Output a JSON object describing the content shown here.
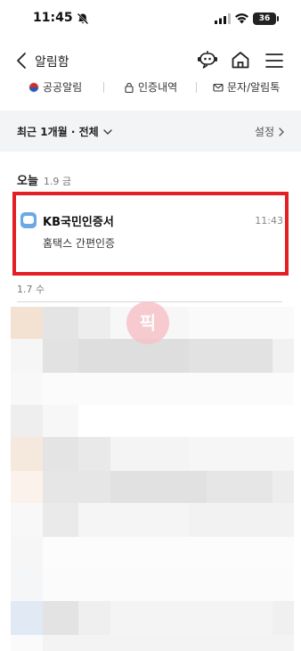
{
  "status_bar": {
    "time": "11:45",
    "battery": "36"
  },
  "header": {
    "title": "알림함"
  },
  "tabs": [
    {
      "label": "공공알림",
      "icon": "korea-flag-icon"
    },
    {
      "label": "인증내역",
      "icon": "lock-icon"
    },
    {
      "label": "문자/알림톡",
      "icon": "envelope-icon"
    }
  ],
  "filter": {
    "label": "최근 1개월 · 전체",
    "settings_label": "설정"
  },
  "groups": [
    {
      "day": "오늘",
      "date": "1.9 금",
      "messages": [
        {
          "sender": "KB국민인증서",
          "time": "11:43",
          "body": "홈택스 간편인증"
        }
      ]
    },
    {
      "date": "1.7 수"
    }
  ],
  "watermark": "픽",
  "colors": {
    "highlight_border": "#e31e24",
    "message_icon": "#6aa9e6",
    "filter_bg": "#f3f4f6"
  }
}
